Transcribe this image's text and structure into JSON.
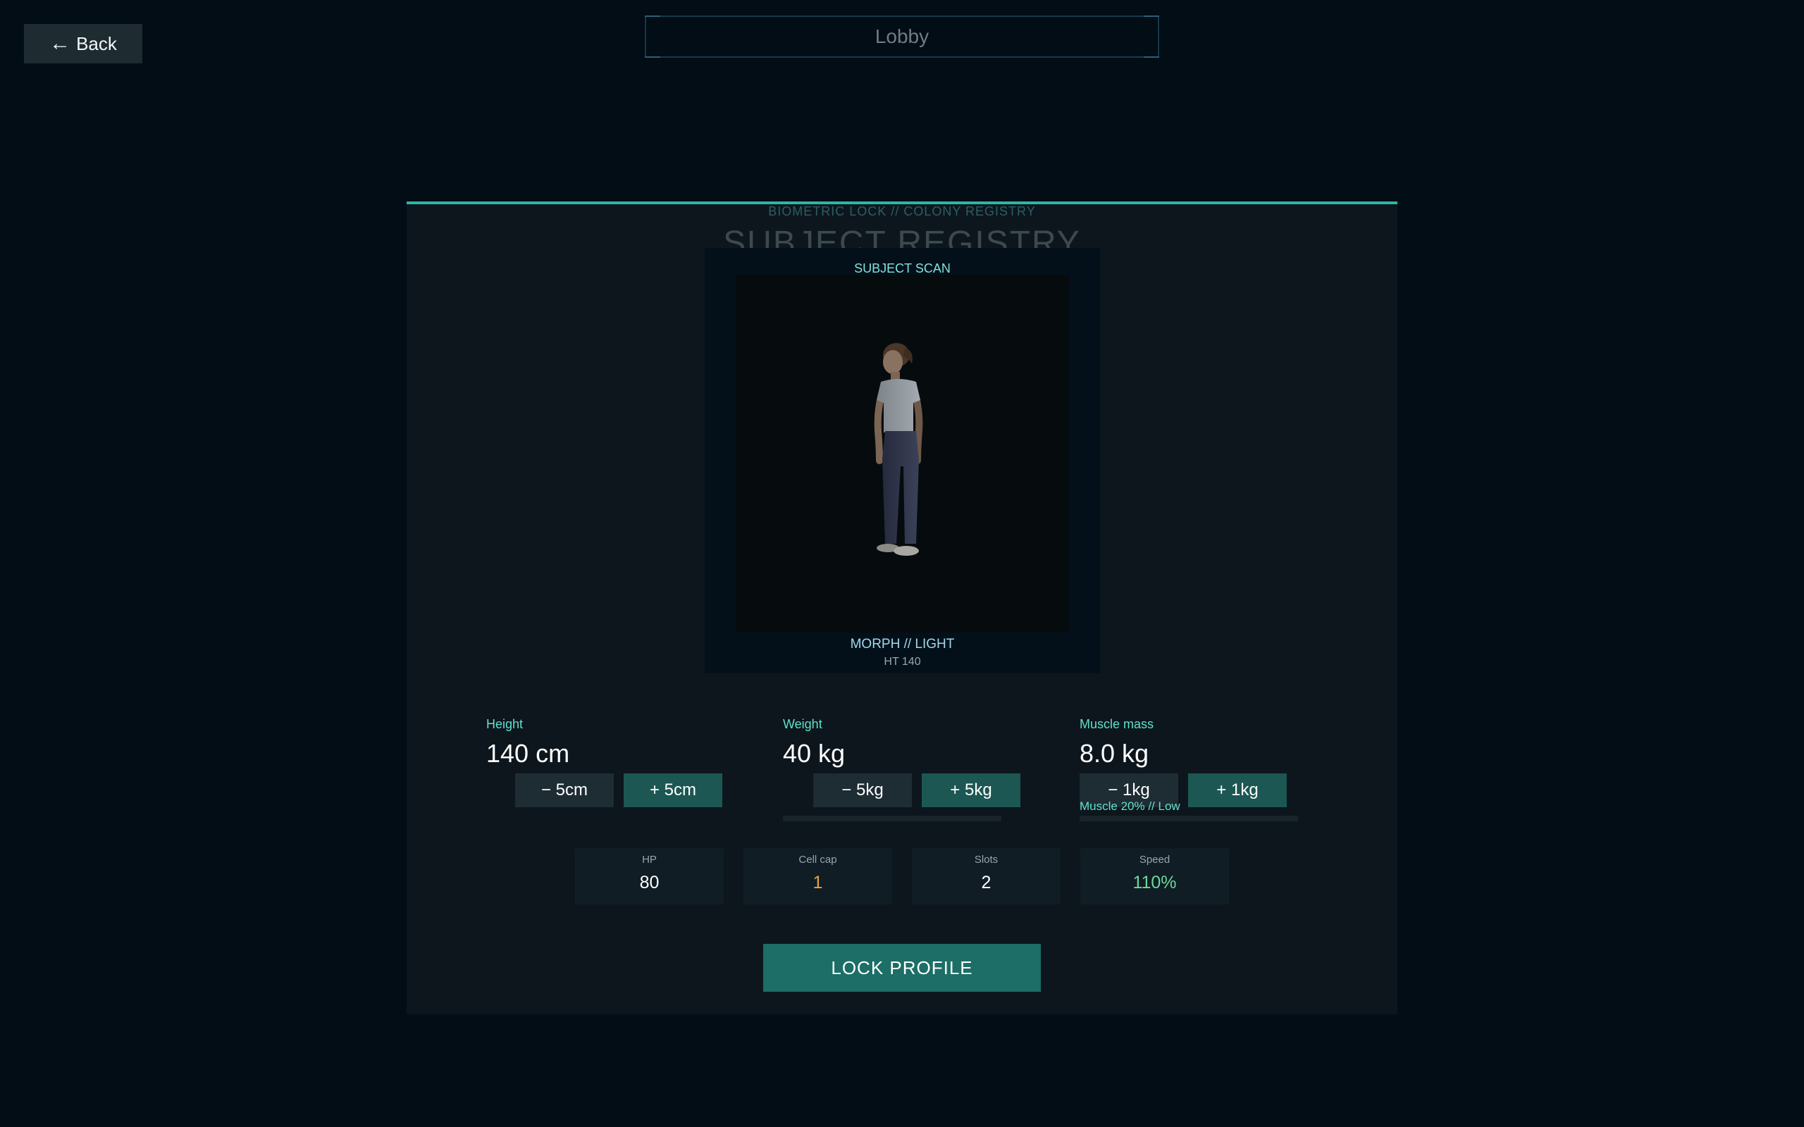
{
  "nav": {
    "back_label": "Back",
    "back_icon": "left-arrow-icon"
  },
  "header": {
    "title": "Lobby"
  },
  "panel": {
    "kicker": "BIOMETRIC LOCK  //  COLONY REGISTRY",
    "title": "SUBJECT REGISTRY",
    "accent_color": "#2fb5a5"
  },
  "scan": {
    "label": "SUBJECT SCAN",
    "morph": "MORPH  //  LIGHT",
    "height_tag": "HT 140"
  },
  "stats": {
    "height": {
      "label": "Height",
      "value": "140 cm",
      "minus_label": "− 5cm",
      "plus_label": "+ 5cm"
    },
    "weight": {
      "label": "Weight",
      "value": "40 kg",
      "minus_label": "− 5kg",
      "plus_label": "+ 5kg"
    },
    "muscle": {
      "label": "Muscle mass",
      "value": "8.0 kg",
      "minus_label": "− 1kg",
      "plus_label": "+ 1kg",
      "note": "Muscle 20%  //  Low"
    }
  },
  "cards": [
    {
      "label": "HP",
      "value": "80",
      "color": "#ffffff"
    },
    {
      "label": "Cell cap",
      "value": "1",
      "color": "#e8a24a"
    },
    {
      "label": "Slots",
      "value": "2",
      "color": "#ffffff"
    },
    {
      "label": "Speed",
      "value": "110%",
      "color": "#6fd79a"
    }
  ],
  "actions": {
    "lock_label": "LOCK PROFILE"
  }
}
